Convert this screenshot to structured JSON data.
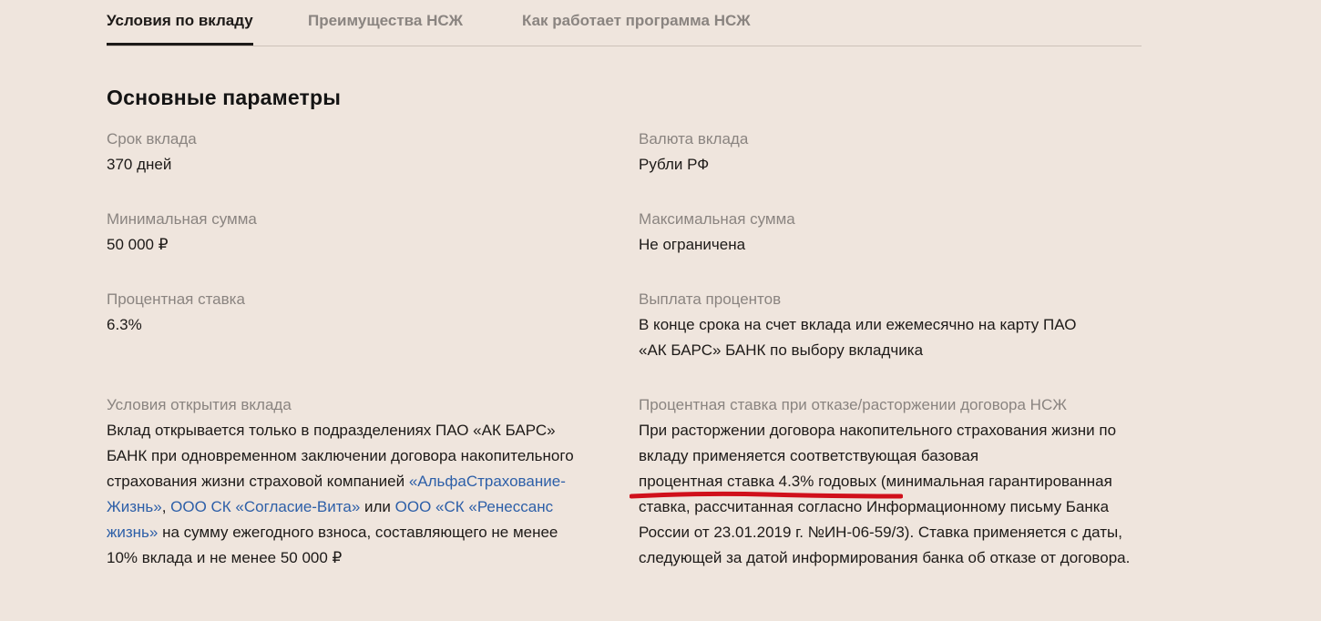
{
  "tabs": [
    {
      "label": "Условия по вкладу",
      "active": true
    },
    {
      "label": "Преимущества НСЖ",
      "active": false
    },
    {
      "label": "Как работает программа НСЖ",
      "active": false
    }
  ],
  "section": {
    "title": "Основные параметры"
  },
  "params": {
    "term": {
      "label": "Срок вклада",
      "value": "370 дней"
    },
    "currency": {
      "label": "Валюта вклада",
      "value": "Рубли РФ"
    },
    "min_sum": {
      "label": "Минимальная сумма",
      "value": "50 000 ₽"
    },
    "max_sum": {
      "label": "Максимальная сумма",
      "value": "Не ограничена"
    },
    "rate": {
      "label": "Процентная ставка",
      "value": "6.3%"
    },
    "payout": {
      "label": "Выплата процентов",
      "value": "В конце срока на счет вклада или ежемесячно на карту ПАО «АК БАРС» БАНК по выбору вкладчика"
    },
    "open_conditions": {
      "label": "Условия открытия вклада",
      "text_1": "Вклад открывается только в подразделениях ПАО «АК БАРС» БАНК при одновременном заключении договора накопительного страхования жизни страховой компанией ",
      "link_1": "«АльфаСтрахование-Жизнь»",
      "text_2": ", ",
      "link_2": "ООО СК «Согласие-Вита»",
      "text_3": " или ",
      "link_3": "ООО «СК «Ренессанс жизнь»",
      "text_4": " на сумму ежегодного взноса, составляющего не менее 10% вклада и не менее 50 000 ₽"
    },
    "termination_rate": {
      "label": "Процентная ставка при отказе/расторжении договора НСЖ",
      "text_1": "При расторжении договора накопительного страхования жизни по вкладу применяется соответствующая базовая ",
      "highlight": "процентная ставка 4.3% годовых",
      "text_2": " (минимальная гарантированная ставка, рассчитанная согласно Информационному письму Банка России от 23.01.2019 г. №ИН-06-59/3). Ставка применяется с даты, следующей за датой информирования банка об отказе от договора."
    }
  },
  "colors": {
    "background": "#efe5dd",
    "text": "#1d1a18",
    "label": "#8a8480",
    "link": "#2d5fa8",
    "highlight_underline": "#d0101b"
  }
}
